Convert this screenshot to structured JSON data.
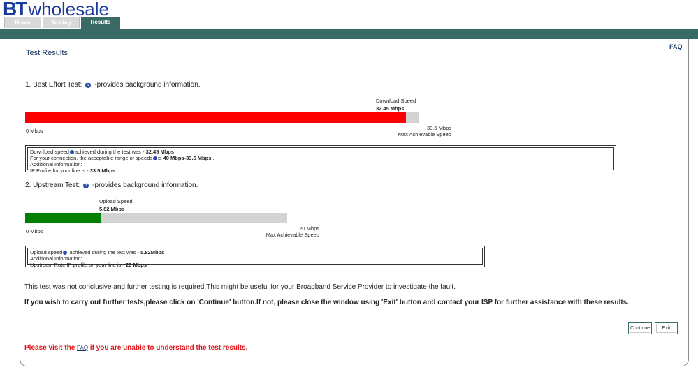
{
  "header": {
    "logo_bt": "BT",
    "logo_wholesale": "wholesale",
    "tabs": [
      {
        "label": "Home"
      },
      {
        "label": "Testing"
      },
      {
        "label": "Results"
      }
    ]
  },
  "page": {
    "faq_link": "FAQ",
    "title": "Test Results"
  },
  "best_effort": {
    "heading": "1. Best Effort Test:",
    "heading_suffix": "-provides background information.",
    "speed_label": "Download Speed",
    "speed_value": "32.45 Mbps",
    "min_label": "0 Mbps",
    "max_value": "33.5 Mbps",
    "max_label": "Max Achievable Speed",
    "fill_fraction": 0.9687,
    "fill_color": "#ff0000",
    "info": {
      "line1_a": "Download speed",
      "line1_b": "achieved during the test was - ",
      "line1_val": "32.45 Mbps",
      "line2_a": "For your connection, the acceptable range of speeds",
      "line2_b": "is ",
      "line2_val": "40 Mbps-33.5 Mbps",
      "line2_end": " .",
      "line3": "Additional Information:",
      "line4_a": "IP Profile for your line is - ",
      "line4_val": "33.5 Mbps"
    }
  },
  "upstream": {
    "heading": "2. Upstream Test:",
    "heading_suffix": "-provides background information.",
    "speed_label": "Upload Speed",
    "speed_value": "5.82 Mbps",
    "min_label": "0 Mbps",
    "max_value": "20 Mbps",
    "max_label": "Max Achievable Speed",
    "fill_fraction": 0.291,
    "fill_color": "#008000",
    "info": {
      "line1_a": "Upload speed",
      "line1_b": " achieved during the test was - ",
      "line1_val": "5.82Mbps",
      "line2": "Additional Information:",
      "line3_a": "Upstream Rate IP profile on your line is - ",
      "line3_val": "20 Mbps"
    }
  },
  "messages": {
    "inconclusive": "This test was not conclusive and further testing is required.This might be useful for your Broadband Service Provider to investigate the fault.",
    "instructions": "If you wish to carry out further tests,please click on 'Continue' button.If not, please close the window using 'Exit' button and contact your ISP for further assistance with these results.",
    "visit_a": "Please visit the ",
    "visit_link": "FAQ",
    "visit_b": " if you are unable to understand the test results."
  },
  "buttons": {
    "continue": "Continue",
    "exit": "Exit"
  },
  "colors": {
    "brand_blue": "#1a3a9c",
    "teal": "#3a6a66",
    "warning_red": "#e3151a"
  }
}
